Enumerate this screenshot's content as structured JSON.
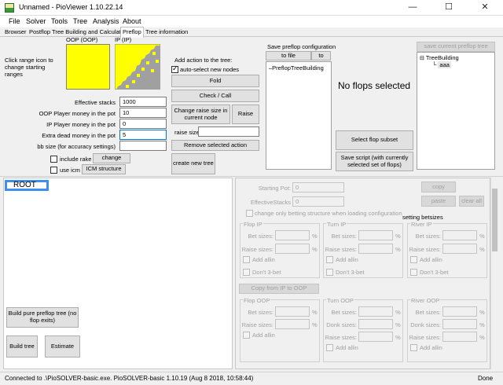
{
  "window": {
    "title": "Unnamed - PioViewer 1.10.22.14",
    "minimize": "—",
    "maximize": "☐",
    "close": "✕"
  },
  "menu": [
    "File",
    "Solver",
    "Tools",
    "Tree",
    "Analysis",
    "About"
  ],
  "tabs": [
    "Browser",
    "Postflop Tree Building and Calculations",
    "Preflop",
    "Tree information"
  ],
  "active_tab": "Preflop",
  "ranges": {
    "hint": "Click range icon to change starting ranges",
    "oop_label": "OOP (OOP)",
    "ip_label": "IP (IP)",
    "oop_color": "#ffff00",
    "ip_color": "#ffff00",
    "fold_color": "#a0a0a0"
  },
  "fields": {
    "effective_stacks_label": "Effective stacks",
    "effective_stacks": "1000",
    "oop_money_label": "OOP Player money in the pot",
    "oop_money": "10",
    "ip_money_label": "IP Player money in the pot",
    "ip_money": "0",
    "dead_money_label": "Extra dead money in the pot",
    "dead_money": "5",
    "bb_size_label": "bb size (for accuracy settings)",
    "bb_size": "",
    "include_rake": "include rake",
    "change": "change",
    "use_icm": "use icm",
    "icm_structure": "ICM structure"
  },
  "actions": {
    "title": "Add action to the tree:",
    "auto_select": "auto-select new nodes",
    "fold": "Fold",
    "check_call": "Check / Call",
    "change_raise": "Change raise size in current node",
    "raise": "Raise",
    "raise_size_label": "raise size",
    "raise_size": "",
    "remove": "Remove selected action",
    "create_new_tree": "create new tree"
  },
  "save_config": {
    "title": "Save preflop configuration",
    "to_file": "to file",
    "to": "to",
    "tree_item": "PreflopTreeBuilding"
  },
  "flops": {
    "message": "No flops selected",
    "select_subset": "Select flop subset",
    "save_script": "Save script (with currently selected set of flops)"
  },
  "right_tree": {
    "save_current": "save current preflop tree",
    "root": "TreeBuilding",
    "child": "aaa"
  },
  "lower_left": {
    "root": "ROOT",
    "build_pure": "Build pure preflop tree (no flop exits)",
    "build_tree": "Build tree",
    "estimate": "Estimate"
  },
  "settings": {
    "starting_pot_label": "Starting Pot:",
    "starting_pot": "0",
    "effective_stacks_label": "EffectiveStacks",
    "effective_stacks": "0",
    "copy": "copy",
    "paste": "paste",
    "clear_all": "clear all",
    "change_only": "change only betting structure when loading configuration",
    "setting_betsizes": "setting betsizes",
    "flop_ip": "Flop IP",
    "turn_ip": "Turn IP",
    "river_ip": "River IP",
    "flop_oop": "Flop OOP",
    "turn_oop": "Turn OOP",
    "river_oop": "River OOP",
    "bet_sizes": "Bet sizes:",
    "raise_sizes": "Raise sizes:",
    "donk_sizes": "Donk sizes:",
    "add_allin": "Add allin",
    "dont_3bet": "Don't 3-bet",
    "percent": "%",
    "copy_ip_oop": "Copy from IP to OOP"
  },
  "status": {
    "connection": "Connected to .\\PioSOLVER-basic.exe. PioSOLVER-basic 1.10.19 (Aug  8 2018, 10:58:44)",
    "done": "Done"
  }
}
